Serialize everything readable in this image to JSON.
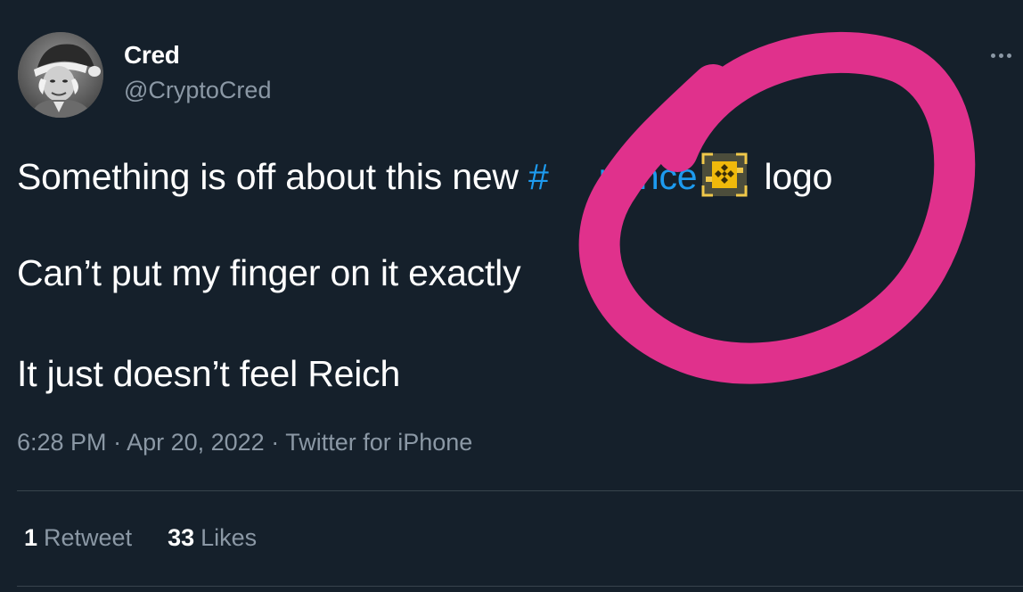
{
  "author": {
    "display_name": "Cred",
    "handle": "@CryptoCred",
    "avatar_icon": "user-avatar-photo"
  },
  "tweet": {
    "line1_prefix": "Something is off about this new ",
    "hashtag": "#Binance",
    "hashtag_visible": "#",
    "hashtag_tail": "nance",
    "emoji_icon": "binance-logo-icon",
    "line1_suffix": " logo",
    "line2": "Can’t put my finger on it exactly",
    "line3": "It just doesn’t feel Reich"
  },
  "meta": {
    "time": "6:28 PM",
    "separator": " · ",
    "date": "Apr 20, 2022",
    "source": "Twitter for iPhone"
  },
  "stats": {
    "retweets_count": "1",
    "retweets_label": "Retweet",
    "likes_count": "33",
    "likes_label": "Likes"
  },
  "colors": {
    "background": "#15202b",
    "text": "#ffffff",
    "secondary_text": "#8b98a5",
    "link": "#1d9bf0",
    "annotation": "#e0318c",
    "binance_yellow": "#f0b90b"
  }
}
